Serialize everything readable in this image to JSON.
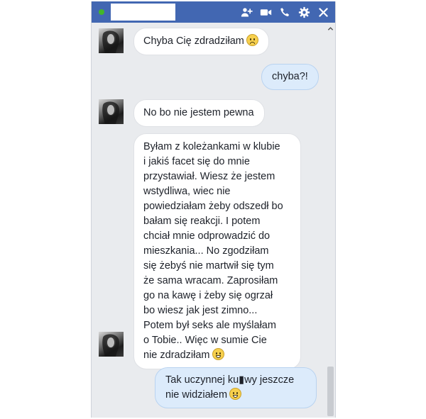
{
  "window": {
    "accent_color": "#4267b2",
    "presence_color": "#42b72a",
    "toolbar_icons": [
      "add-person-icon",
      "video-call-icon",
      "phone-icon",
      "gear-icon",
      "close-icon"
    ]
  },
  "messages": [
    {
      "direction": "incoming",
      "text": "Chyba Cię zdradziłam",
      "emoji": "frown-emoji-icon"
    },
    {
      "direction": "outgoing",
      "text": "chyba?!"
    },
    {
      "direction": "incoming",
      "text": "No bo nie jestem pewna"
    },
    {
      "direction": "incoming",
      "lines": [
        "Byłam z koleżankami w klubie",
        "i jakiś facet się do mnie",
        "przystawiał. Wiesz że jestem",
        "wstydliwa, wiec nie",
        "powiedziałam żeby odszedł bo",
        "bałam się reakcji. I potem",
        "chciał mnie odprowadzić do",
        "mieszkania... No zgodziłam",
        "się żebyś nie martwił się tym",
        "że sama wracam. Zaprosiłam",
        "go na kawę i żeby się ogrzał",
        "bo wiesz jak jest zimno...",
        "Potem był seks ale myślałam",
        "o Tobie.. Więc w sumie Cie",
        "nie zdradziłam"
      ],
      "emoji": "grin-emoji-icon"
    },
    {
      "direction": "outgoing",
      "lines": [
        "Tak uczynnej ku▮wy jeszcze",
        "nie widziałem"
      ],
      "emoji": "grin-emoji-icon"
    }
  ]
}
